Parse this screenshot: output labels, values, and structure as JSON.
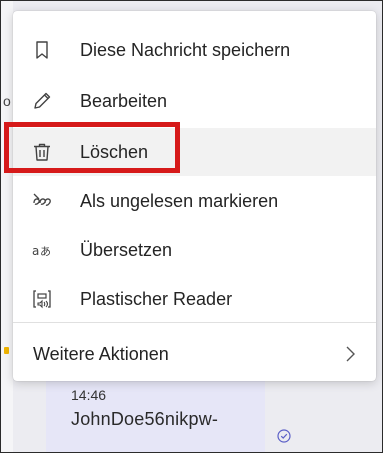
{
  "menu": {
    "items": [
      {
        "label": "Diese Nachricht speichern",
        "icon": "bookmark-icon"
      },
      {
        "label": "Bearbeiten",
        "icon": "pencil-icon"
      },
      {
        "label": "Löschen",
        "icon": "trash-icon"
      },
      {
        "label": "Als ungelesen markieren",
        "icon": "mark-unread-icon"
      },
      {
        "label": "Übersetzen",
        "icon": "translate-icon"
      },
      {
        "label": "Plastischer Reader",
        "icon": "immersive-reader-icon"
      }
    ],
    "more_label": "Weitere Aktionen"
  },
  "background": {
    "left_letter": "o",
    "message_time": "14:46",
    "message_author": "JohnDoe56nikpw-"
  },
  "colors": {
    "highlight_box": "#d61a1a",
    "menu_bg": "#ffffff",
    "hover_bg": "#f2f2f2",
    "bubble_bg": "#e6e6f7",
    "read_receipt": "#5b5fc7"
  }
}
